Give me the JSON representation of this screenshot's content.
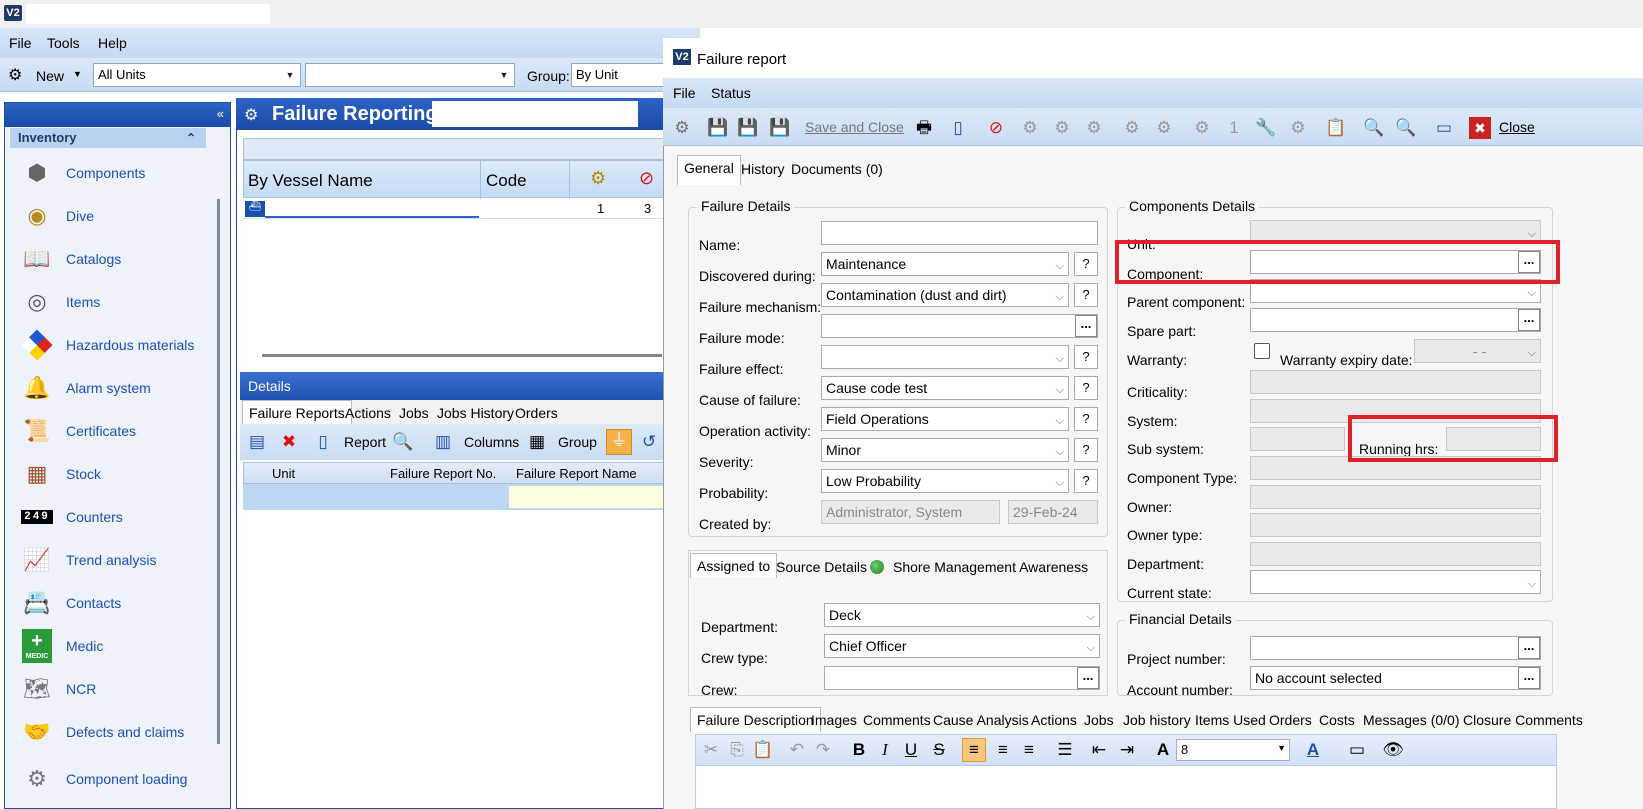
{
  "app": {
    "logo": "V2"
  },
  "menubar": {
    "file": "File",
    "tools": "Tools",
    "help": "Help"
  },
  "toolbar": {
    "new_label": "New",
    "units_combo": "All Units",
    "second_combo": "",
    "group_label": "Group:",
    "group_value": "By Unit"
  },
  "sidebar": {
    "section_title": "Inventory",
    "items": [
      {
        "label": "Components",
        "icon": "components-icon"
      },
      {
        "label": "Dive",
        "icon": "dive-helmet-icon"
      },
      {
        "label": "Catalogs",
        "icon": "catalog-book-icon"
      },
      {
        "label": "Items",
        "icon": "bearing-icon"
      },
      {
        "label": "Hazardous materials",
        "icon": "hazard-diamond-icon"
      },
      {
        "label": "Alarm system",
        "icon": "alarm-bell-icon"
      },
      {
        "label": "Certificates",
        "icon": "certificate-icon"
      },
      {
        "label": "Stock",
        "icon": "stock-shelves-icon"
      },
      {
        "label": "Counters",
        "icon": "counter-icon"
      },
      {
        "label": "Trend analysis",
        "icon": "trend-chart-icon"
      },
      {
        "label": "Contacts",
        "icon": "contacts-icon"
      },
      {
        "label": "Medic",
        "icon": "medic-cross-icon"
      },
      {
        "label": "NCR",
        "icon": "ncr-icon"
      },
      {
        "label": "Defects and claims",
        "icon": "defects-icon"
      },
      {
        "label": "Component loading",
        "icon": "component-loading-icon"
      }
    ]
  },
  "counter_digits": "249",
  "medic_badge": "MEDIC",
  "failure_reporting": {
    "title": "Failure Reporting",
    "grid_cols": [
      "By Vessel Name",
      "Code"
    ],
    "row": {
      "c1": "1",
      "c2": "3"
    }
  },
  "details": {
    "title": "Details",
    "tabs": [
      "Failure Reports",
      "Actions",
      "Jobs",
      "Jobs History",
      "Orders"
    ],
    "toolbar": {
      "report": "Report",
      "columns": "Columns",
      "group": "Group"
    },
    "cols": [
      "Unit",
      "Failure Report No.",
      "Failure Report Name"
    ]
  },
  "dialog": {
    "title": "Failure report",
    "menu": {
      "file": "File",
      "status": "Status"
    },
    "save_close": "Save and Close",
    "close": "Close",
    "tabs": [
      "General",
      "History",
      "Documents (0)"
    ],
    "failure_details": {
      "title": "Failure Details",
      "name_label": "Name:",
      "name_value": "",
      "discovered_label": "Discovered during:",
      "discovered_value": "Maintenance",
      "mechanism_label": "Failure mechanism:",
      "mechanism_value": "Contamination (dust and dirt)",
      "mode_label": "Failure mode:",
      "mode_value": "",
      "effect_label": "Failure effect:",
      "effect_value": "",
      "cause_label": "Cause of failure:",
      "cause_value": "Cause code test",
      "operation_label": "Operation activity:",
      "operation_value": "Field Operations",
      "severity_label": "Severity:",
      "severity_value": "Minor",
      "probability_label": "Probability:",
      "probability_value": "Low Probability",
      "created_label": "Created by:",
      "created_value": "Administrator, System",
      "created_date": "29-Feb-24"
    },
    "assigned": {
      "tabs": [
        "Assigned to",
        "Source Details",
        "Shore Management Awareness"
      ],
      "department_label": "Department:",
      "department_value": "Deck",
      "crew_type_label": "Crew type:",
      "crew_type_value": "Chief Officer",
      "crew_label": "Crew:",
      "crew_value": ""
    },
    "components": {
      "title": "Components Details",
      "unit_label": "Unit:",
      "component_label": "Component:",
      "parent_label": "Parent component:",
      "spare_label": "Spare part:",
      "warranty_label": "Warranty:",
      "warranty_expiry_label": "Warranty expiry date:",
      "warranty_expiry_value": "-  -",
      "criticality_label": "Criticality:",
      "system_label": "System:",
      "subsystem_label": "Sub system:",
      "running_label": "Running hrs:",
      "comp_type_label": "Component Type:",
      "owner_label": "Owner:",
      "owner_type_label": "Owner type:",
      "department_label": "Department:",
      "state_label": "Current state:"
    },
    "financial": {
      "title": "Financial Details",
      "project_label": "Project number:",
      "project_value": "",
      "account_label": "Account number:",
      "account_value": "No account selected"
    },
    "bottom_tabs": [
      "Failure Description",
      "Images",
      "Comments",
      "Cause Analysis",
      "Actions",
      "Jobs",
      "Job history",
      "Items Used",
      "Orders",
      "Costs",
      "Messages (0/0)",
      "Closure Comments"
    ],
    "editor": {
      "font_size": "8"
    }
  },
  "colors": {
    "highlight": "#e0202a",
    "nav_text": "#1c4fb4",
    "header_blue": "#1f50ae"
  }
}
